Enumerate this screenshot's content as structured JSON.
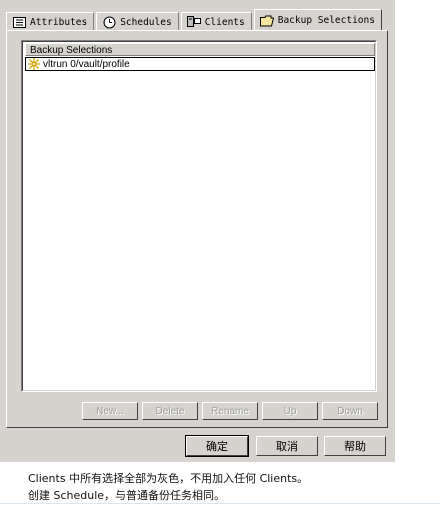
{
  "tabs": [
    {
      "label": "Attributes",
      "icon": "list-icon"
    },
    {
      "label": "Schedules",
      "icon": "clock-icon"
    },
    {
      "label": "Clients",
      "icon": "client-icon"
    },
    {
      "label": "Backup Selections",
      "icon": "folder-icon",
      "active": true
    }
  ],
  "list": {
    "header": "Backup Selections",
    "items": [
      {
        "path": "vltrun 0/vault/profile",
        "icon": "star-icon"
      }
    ]
  },
  "actions": {
    "new": "New...",
    "delete": "Delete",
    "rename": "Rename",
    "up": "Up",
    "down": "Down"
  },
  "dialog_buttons": {
    "ok": "确定",
    "cancel": "取消",
    "help": "帮助"
  },
  "caption": {
    "line1": "Clients 中所有选择全部为灰色，不用加入任何 Clients。",
    "line2": "创建 Schedule，与普通备份任务相同。"
  }
}
